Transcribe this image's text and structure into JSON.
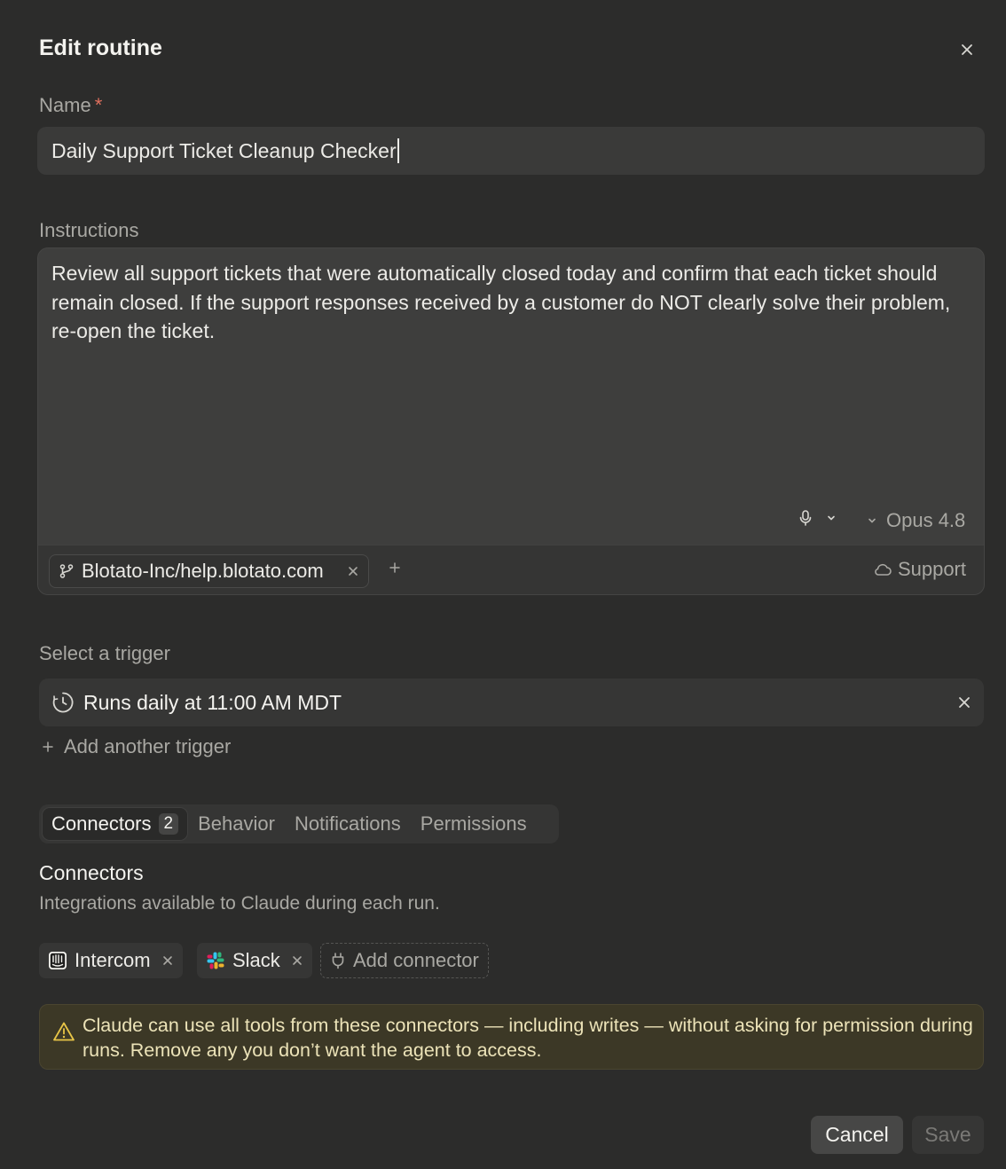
{
  "dialog": {
    "title": "Edit routine"
  },
  "name": {
    "label": "Name",
    "required_mark": "*",
    "value": "Daily Support Ticket Cleanup Checker"
  },
  "instructions": {
    "label": "Instructions",
    "value": "Review all support tickets that were automatically closed today and confirm that each ticket should remain closed. If the support responses received by a customer do NOT clearly solve their problem, re-open the ticket.",
    "model": "Opus 4.8",
    "repo": "Blotato-Inc/help.blotato.com",
    "environment": "Support"
  },
  "trigger": {
    "label": "Select a trigger",
    "current": "Runs daily at 11:00 AM MDT",
    "add_label": "Add another trigger"
  },
  "tabs": [
    {
      "label": "Connectors",
      "count": "2",
      "active": true
    },
    {
      "label": "Behavior"
    },
    {
      "label": "Notifications"
    },
    {
      "label": "Permissions"
    }
  ],
  "connectors": {
    "title": "Connectors",
    "subtitle": "Integrations available to Claude during each run.",
    "items": [
      {
        "label": "Intercom",
        "icon": "intercom-icon"
      },
      {
        "label": "Slack",
        "icon": "slack-icon"
      }
    ],
    "add_label": "Add connector",
    "warning": "Claude can use all tools from these connectors — including writes — without asking for permission during runs. Remove any you don’t want the agent to access."
  },
  "footer": {
    "cancel": "Cancel",
    "save": "Save"
  },
  "colors": {
    "background": "#2c2c2b",
    "required": "#e0705e",
    "warning_bg": "#3c3826",
    "warning_icon": "#e8c547"
  }
}
